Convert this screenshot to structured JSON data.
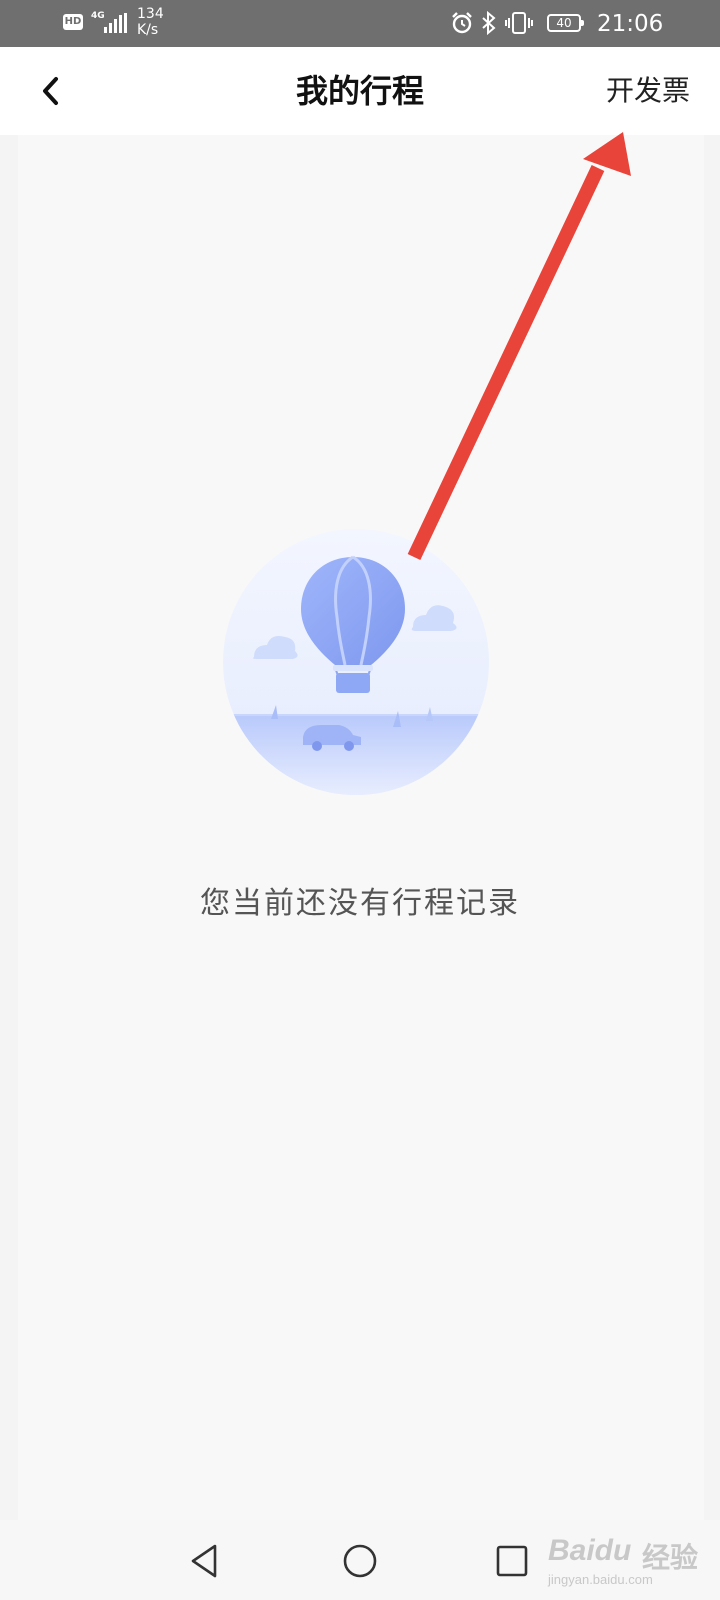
{
  "status_bar": {
    "hd": "HD",
    "network": "4G",
    "speed_value": "134",
    "speed_unit": "K/s",
    "battery": "40",
    "time": "21:06",
    "icons": [
      "alarm-icon",
      "bluetooth-icon",
      "vibrate-icon",
      "battery-icon"
    ]
  },
  "header": {
    "back_icon": "chevron-left-icon",
    "title": "我的行程",
    "action_label": "开发票"
  },
  "empty_state": {
    "illustration": "hot-air-balloon-illustration",
    "message": "您当前还没有行程记录"
  },
  "annotation": {
    "arrow_color": "#e8443a",
    "points_to": "开发票"
  },
  "system_nav": {
    "icons": [
      "back-triangle-icon",
      "home-circle-icon",
      "recents-square-icon"
    ]
  },
  "watermark": {
    "brand": "Baidu",
    "suffix": "经验",
    "url": "jingyan.baidu.com"
  },
  "colors": {
    "status_bar_bg": "#6f6f6f",
    "header_bg": "#ffffff",
    "content_bg": "#f8f8f8",
    "illustration_blue": "#8ea8f5"
  }
}
